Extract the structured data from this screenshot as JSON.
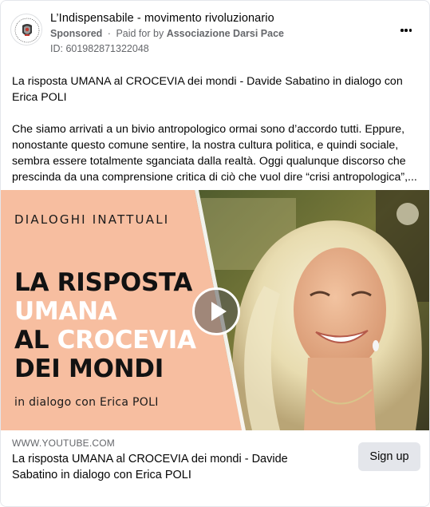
{
  "post": {
    "page_name": "L’Indispensabile - movimento rivoluzionario",
    "sponsored_label": "Sponsored",
    "separator": "·",
    "paid_for_prefix": "Paid for by",
    "advertiser": "Associazione Darsi Pace",
    "ad_id": "ID: 601982871322048",
    "title_text": "La risposta UMANA al CROCEVIA dei mondi - Davide Sabatino in dialogo con Erica POLI",
    "body_text": "Che siamo arrivati a un bivio antropologico ormai sono d’accordo tutti. Eppure, nonostante questo comune sentire, la nostra cultura politica, e quindi sociale, sembra essere totalmente sganciata dalla realtà. Oggi qualunque discorso che prescinda da una comprensione critica di ciò che vuol dire “crisi antropologica”,..."
  },
  "media": {
    "overline": "DIALOGHI INATTUALI",
    "headline": {
      "line1": "LA RISPOSTA",
      "line2": "UMANA",
      "line3_dark": "AL ",
      "line3_light": "CROCEVIA",
      "line4": "DEI MONDI"
    },
    "subline": "in dialogo con Erica POLI",
    "banner_color": "#f7bea0",
    "play_icon": "play-icon"
  },
  "link_preview": {
    "domain": "WWW.YOUTUBE.COM",
    "title": "La risposta UMANA al CROCEVIA dei mondi - Davide Sabatino in dialogo con Erica POLI",
    "cta_label": "Sign up"
  },
  "icons": {
    "more": "more-options-icon",
    "avatar": "page-logo-avatar"
  }
}
